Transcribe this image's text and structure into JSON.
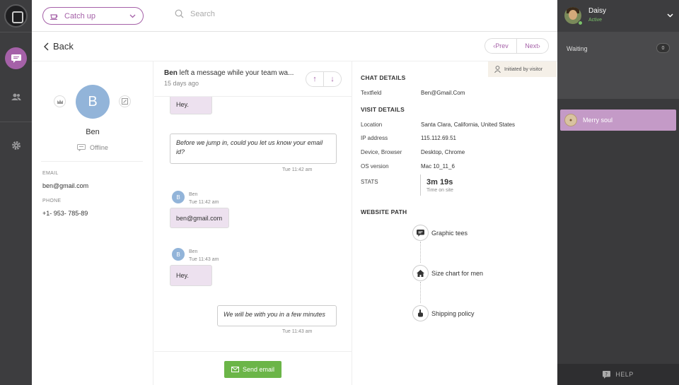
{
  "topbar": {
    "status_label": "Catch up",
    "search_placeholder": "Search"
  },
  "nav": {
    "back_label": "Back",
    "prev_label": "Prev",
    "next_label": "Next"
  },
  "profile": {
    "initial": "B",
    "name": "Ben",
    "status": "Offline",
    "email_label": "EMAIL",
    "email": "ben@gmail.com",
    "phone_label": "PHONE",
    "phone": "+1- 953- 785-89"
  },
  "chat": {
    "header_sender": "Ben",
    "header_text": " left a message while your team wa...",
    "header_time": "15 days ago",
    "messages": [
      {
        "type": "in",
        "text": "Hey."
      },
      {
        "type": "out",
        "text": "Before we jump in, could you let us know your email id?",
        "time": "Tue 11:42 am"
      },
      {
        "type": "in",
        "sender": "Ben",
        "time": "Tue 11:42 am",
        "initial": "B",
        "text": "ben@gmail.com"
      },
      {
        "type": "in",
        "sender": "Ben",
        "time": "Tue 11:43 am",
        "initial": "B",
        "text": "Hey."
      },
      {
        "type": "out",
        "text": "We will be with you in a few minutes",
        "time": "Tue 11:43 am"
      }
    ],
    "send_email_label": "Send email"
  },
  "details": {
    "initiated_label": "Initiated by visitor",
    "chat_details_title": "CHAT DETAILS",
    "textfield_key": "Textfield",
    "textfield_value": "Ben@Gmail.Com",
    "visit_details_title": "VISIT DETAILS",
    "location_key": "Location",
    "location_value": "Santa Clara, California, United States",
    "ip_key": "IP address",
    "ip_value": "115.112.69.51",
    "device_key": "Device, Browser",
    "device_value": "Desktop, Chrome",
    "os_key": "OS version",
    "os_value": "Mac 10_11_6",
    "stats_key": "STATS",
    "stats_value": "3m 19s",
    "stats_sub": "Time on site",
    "website_path_title": "WEBSITE PATH",
    "path": [
      {
        "icon": "chat-bubble-icon",
        "label": "Graphic tees"
      },
      {
        "icon": "home-icon",
        "label": "Size chart for men"
      },
      {
        "icon": "pointer-hand-icon",
        "label": "Shipping policy"
      }
    ]
  },
  "agent": {
    "name": "Daisy",
    "status": "Active"
  },
  "queue": {
    "waiting_label": "Waiting",
    "waiting_count": "0",
    "conversations": [
      {
        "name": "Merry soul"
      }
    ]
  },
  "help_label": "HELP",
  "colors": {
    "accent": "#a561a8",
    "send_button": "#6bb548",
    "incoming_bubble": "#ede1ef",
    "avatar": "#92b4d9",
    "active_conversation": "#c49ac7"
  }
}
